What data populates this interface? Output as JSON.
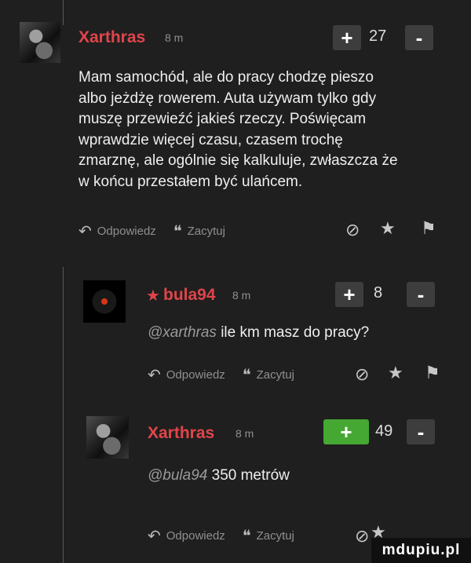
{
  "comments": [
    {
      "username": "Xarthras",
      "time": "8 m",
      "score": "27",
      "upvote_label": "+",
      "downvote_label": "-",
      "body_lines": [
        "Mam samochód, ale do pracy chodzę pieszo",
        "albo jeżdżę rowerem. Auta używam tylko gdy",
        "muszę przewieźć jakieś rzeczy. Poświęcam",
        "wprawdzie więcej czasu, czasem trochę",
        "zmarznę, ale ogólnie się kalkuluje, zwłaszcza że",
        "w końcu przestałem być ulańcem."
      ],
      "reply_label": "Odpowiedz",
      "quote_label": "Zacytuj"
    },
    {
      "username": "bula94",
      "time": "8 m",
      "score": "8",
      "upvote_label": "+",
      "downvote_label": "-",
      "mention": "@xarthras",
      "body": "ile km masz do pracy?",
      "reply_label": "Odpowiedz",
      "quote_label": "Zacytuj"
    },
    {
      "username": "Xarthras",
      "time": "8 m",
      "score": "49",
      "upvote_label": "+",
      "downvote_label": "-",
      "mention": "@bula94",
      "body": "350 metrów",
      "reply_label": "Odpowiedz",
      "quote_label": "Zacytuj"
    }
  ],
  "watermark": "mdupiu.pl",
  "colors": {
    "background": "#1f1f1f",
    "username": "#e0454a",
    "upvote_active": "#45a833",
    "button": "#3d3d3d"
  },
  "icons": {
    "reply": "reply-arrow-icon",
    "quote": "quote-icon",
    "block": "block-icon",
    "favorite": "star-icon",
    "report": "flag-icon",
    "op_marker": "star-icon"
  }
}
